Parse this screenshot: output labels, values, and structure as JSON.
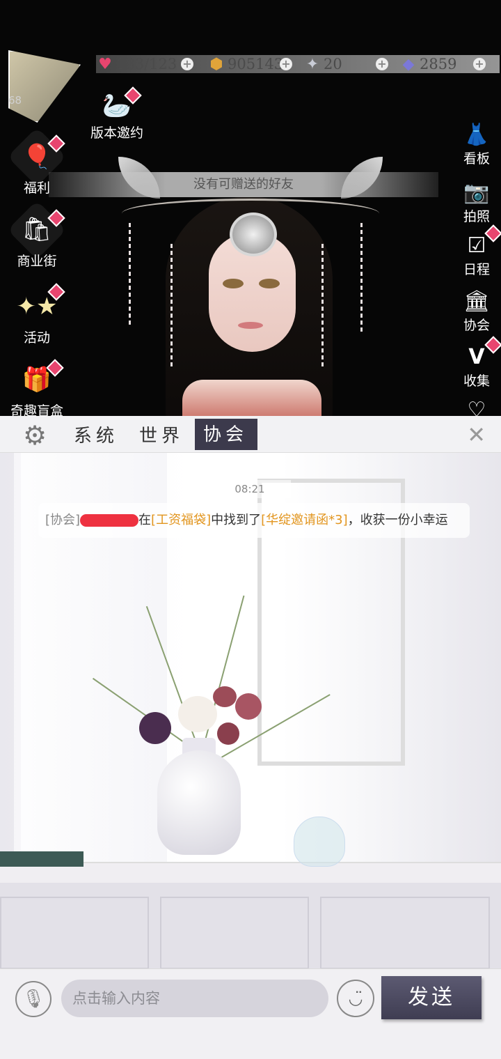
{
  "resources": {
    "stamina": "183/123",
    "gold": "905143",
    "crystal": "20",
    "diamond": "2859"
  },
  "player": {
    "level": "68"
  },
  "left_menu": {
    "version_invite": "版本邀约",
    "welfare": "福利",
    "shopping_street": "商业街",
    "activity": "活动",
    "blind_box": "奇趣盲盒"
  },
  "right_menu": {
    "board": "看板",
    "photo": "拍照",
    "schedule": "日程",
    "association": "协会",
    "collection": "收集"
  },
  "notice": "没有可赠送的好友",
  "tabs": {
    "system": "系统",
    "world": "世界",
    "association": "协会"
  },
  "chat": {
    "time": "08:21",
    "message": {
      "channel": "[协会]",
      "action": "在",
      "item_source": "[工资福袋]",
      "found": "中找到了",
      "item": "[华绽邀请函*3]",
      "suffix": "，收获一份小幸运"
    }
  },
  "input": {
    "placeholder": "点击输入内容",
    "send": "发送"
  },
  "colors": {
    "accent": "#3c3a4c",
    "highlight": "#e2951e",
    "badge": "#e8456f"
  }
}
